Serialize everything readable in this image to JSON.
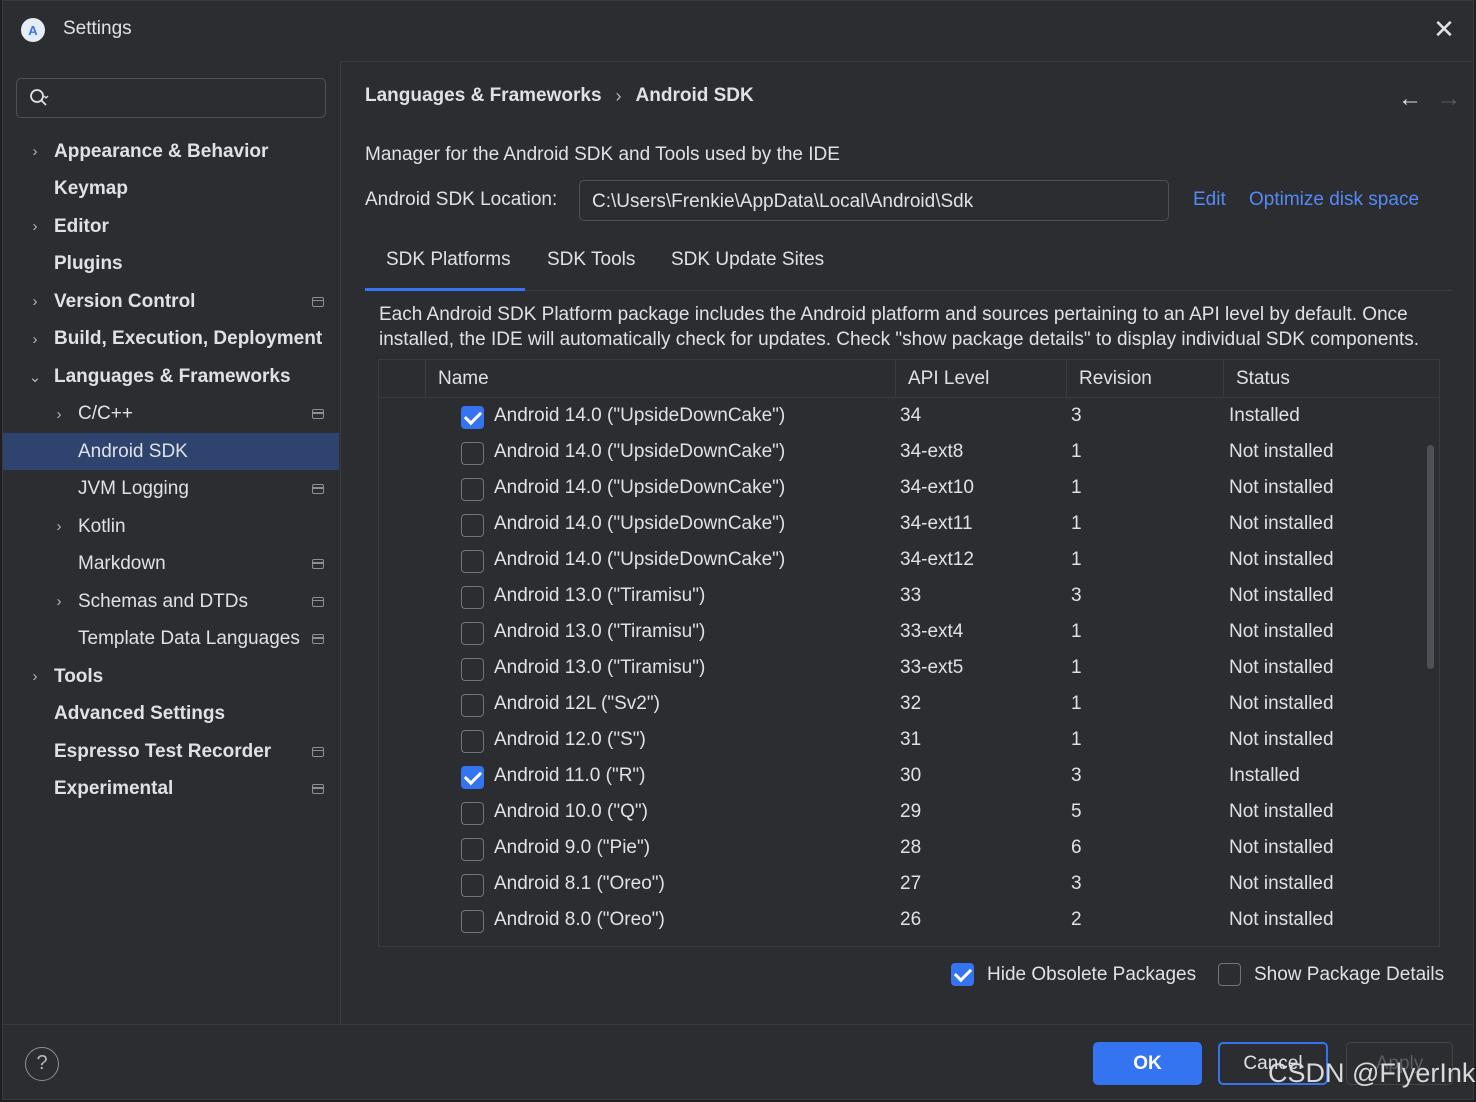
{
  "window": {
    "title": "Settings",
    "logo_glyph": "A"
  },
  "sidebar": {
    "items": [
      {
        "label": "Appearance & Behavior",
        "bold": true,
        "chevron": "›",
        "level": 0,
        "badge": false
      },
      {
        "label": "Keymap",
        "bold": true,
        "chevron": "",
        "level": 0,
        "badge": false
      },
      {
        "label": "Editor",
        "bold": true,
        "chevron": "›",
        "level": 0,
        "badge": false
      },
      {
        "label": "Plugins",
        "bold": true,
        "chevron": "",
        "level": 0,
        "badge": false
      },
      {
        "label": "Version Control",
        "bold": true,
        "chevron": "›",
        "level": 0,
        "badge": true
      },
      {
        "label": "Build, Execution, Deployment",
        "bold": true,
        "chevron": "›",
        "level": 0,
        "badge": false
      },
      {
        "label": "Languages & Frameworks",
        "bold": true,
        "chevron": "⌄",
        "level": 0,
        "badge": false
      },
      {
        "label": "C/C++",
        "bold": false,
        "chevron": "›",
        "level": 1,
        "badge": true
      },
      {
        "label": "Android SDK",
        "bold": false,
        "chevron": "",
        "level": 1,
        "badge": false,
        "selected": true
      },
      {
        "label": "JVM Logging",
        "bold": false,
        "chevron": "",
        "level": 1,
        "badge": true
      },
      {
        "label": "Kotlin",
        "bold": false,
        "chevron": "›",
        "level": 1,
        "badge": false
      },
      {
        "label": "Markdown",
        "bold": false,
        "chevron": "",
        "level": 1,
        "badge": true
      },
      {
        "label": "Schemas and DTDs",
        "bold": false,
        "chevron": "›",
        "level": 1,
        "badge": true
      },
      {
        "label": "Template Data Languages",
        "bold": false,
        "chevron": "",
        "level": 1,
        "badge": true
      },
      {
        "label": "Tools",
        "bold": true,
        "chevron": "›",
        "level": 0,
        "badge": false
      },
      {
        "label": "Advanced Settings",
        "bold": true,
        "chevron": "",
        "level": 0,
        "badge": false
      },
      {
        "label": "Espresso Test Recorder",
        "bold": true,
        "chevron": "",
        "level": 0,
        "badge": true
      },
      {
        "label": "Experimental",
        "bold": true,
        "chevron": "",
        "level": 0,
        "badge": true
      }
    ]
  },
  "content": {
    "breadcrumb": [
      "Languages & Frameworks",
      "Android SDK"
    ],
    "breadcrumb_sep": "›",
    "nav_back": "←",
    "nav_forward": "→",
    "description": "Manager for the Android SDK and Tools used by the IDE",
    "location_label": "Android SDK Location:",
    "location_value": "C:\\Users\\Frenkie\\AppData\\Local\\Android\\Sdk",
    "edit_link": "Edit",
    "optimize_link": "Optimize disk space",
    "tabs": [
      "SDK Platforms",
      "SDK Tools",
      "SDK Update Sites"
    ],
    "active_tab": "SDK Platforms",
    "info_text": "Each Android SDK Platform package includes the Android platform and sources pertaining to an API level by default. Once installed, the IDE will automatically check for updates. Check \"show package details\" to display individual SDK components.",
    "table": {
      "headers": [
        "Name",
        "API Level",
        "Revision",
        "Status"
      ],
      "rows": [
        {
          "checked": true,
          "name": "Android 14.0 (\"UpsideDownCake\")",
          "api": "34",
          "rev": "3",
          "status": "Installed"
        },
        {
          "checked": false,
          "name": "Android 14.0 (\"UpsideDownCake\")",
          "api": "34-ext8",
          "rev": "1",
          "status": "Not installed"
        },
        {
          "checked": false,
          "name": "Android 14.0 (\"UpsideDownCake\")",
          "api": "34-ext10",
          "rev": "1",
          "status": "Not installed"
        },
        {
          "checked": false,
          "name": "Android 14.0 (\"UpsideDownCake\")",
          "api": "34-ext11",
          "rev": "1",
          "status": "Not installed"
        },
        {
          "checked": false,
          "name": "Android 14.0 (\"UpsideDownCake\")",
          "api": "34-ext12",
          "rev": "1",
          "status": "Not installed"
        },
        {
          "checked": false,
          "name": "Android 13.0 (\"Tiramisu\")",
          "api": "33",
          "rev": "3",
          "status": "Not installed"
        },
        {
          "checked": false,
          "name": "Android 13.0 (\"Tiramisu\")",
          "api": "33-ext4",
          "rev": "1",
          "status": "Not installed"
        },
        {
          "checked": false,
          "name": "Android 13.0 (\"Tiramisu\")",
          "api": "33-ext5",
          "rev": "1",
          "status": "Not installed"
        },
        {
          "checked": false,
          "name": "Android 12L (\"Sv2\")",
          "api": "32",
          "rev": "1",
          "status": "Not installed"
        },
        {
          "checked": false,
          "name": "Android 12.0 (\"S\")",
          "api": "31",
          "rev": "1",
          "status": "Not installed"
        },
        {
          "checked": true,
          "name": "Android 11.0 (\"R\")",
          "api": "30",
          "rev": "3",
          "status": "Installed"
        },
        {
          "checked": false,
          "name": "Android 10.0 (\"Q\")",
          "api": "29",
          "rev": "5",
          "status": "Not installed"
        },
        {
          "checked": false,
          "name": "Android 9.0 (\"Pie\")",
          "api": "28",
          "rev": "6",
          "status": "Not installed"
        },
        {
          "checked": false,
          "name": "Android 8.1 (\"Oreo\")",
          "api": "27",
          "rev": "3",
          "status": "Not installed"
        },
        {
          "checked": false,
          "name": "Android 8.0 (\"Oreo\")",
          "api": "26",
          "rev": "2",
          "status": "Not installed"
        }
      ]
    },
    "hide_obsolete_label": "Hide Obsolete Packages",
    "hide_obsolete_checked": true,
    "show_details_label": "Show Package Details",
    "show_details_checked": false
  },
  "footer": {
    "help_glyph": "?",
    "ok_label": "OK",
    "cancel_label": "Cancel",
    "apply_label": "Apply"
  },
  "watermark": "CSDN @FlyerInk",
  "colors": {
    "accent": "#3574f0",
    "link": "#548af7",
    "selected_bg": "#2e436e",
    "bg": "#2b2d30"
  }
}
